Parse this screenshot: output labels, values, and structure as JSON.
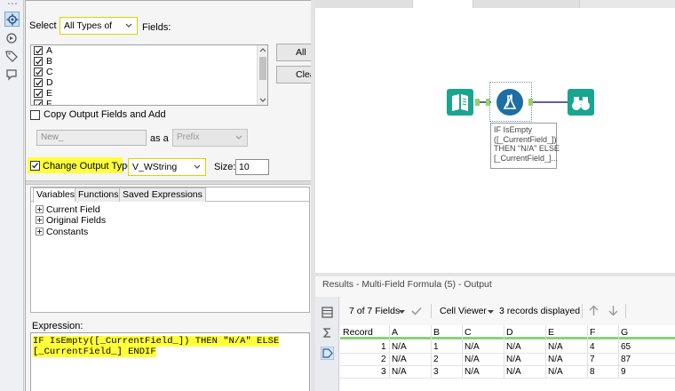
{
  "config": {
    "select_label": "Select",
    "select_value": "All Types of",
    "fields_label": "Fields:",
    "fields": [
      "A",
      "B",
      "C",
      "D",
      "E",
      "F"
    ],
    "all_button": "All",
    "clear_button": "Clear",
    "copy_output_label": "Copy Output Fields and Add",
    "prefix_text": "New_",
    "as_a_label": "as a",
    "prefix_option": "Prefix",
    "change_type_label": "Change Output Type to",
    "type_value": "V_WString",
    "size_label": "Size:",
    "size_value": "10"
  },
  "variables": {
    "tabs": [
      "Variables",
      "Functions",
      "Saved Expressions"
    ],
    "tree": [
      "Current Field",
      "Original Fields",
      "Constants"
    ]
  },
  "expression": {
    "label": "Expression:",
    "line1": "IF IsEmpty([_CurrentField_]) THEN \"N/A\" ELSE",
    "line2": "[_CurrentField_] ENDIF"
  },
  "workflow": {
    "annotation": [
      "IF IsEmpty",
      "([_CurrentField_])",
      "THEN \"N/A\" ELSE",
      "[_CurrentField_]..."
    ]
  },
  "results": {
    "title": "Results - Multi-Field Formula (5) - Output",
    "fields_count": "7 of 7 Fields",
    "viewer": "Cell Viewer",
    "records_displayed": "3 records displayed",
    "columns": [
      "Record",
      "A",
      "B",
      "C",
      "D",
      "E",
      "F",
      "G"
    ],
    "rows": [
      [
        "1",
        "N/A",
        "1",
        "N/A",
        "N/A",
        "N/A",
        "4",
        "65"
      ],
      [
        "2",
        "N/A",
        "2",
        "N/A",
        "N/A",
        "N/A",
        "7",
        "87"
      ],
      [
        "3",
        "N/A",
        "3",
        "N/A",
        "N/A",
        "N/A",
        "8",
        "9"
      ]
    ]
  },
  "colors": {
    "highlight": "#ffff3c",
    "input_tool": "#1aa58e",
    "formula_tool": "#1c6ea4",
    "browse_tool": "#1aa58e",
    "header_underline": "#8cd17a"
  }
}
